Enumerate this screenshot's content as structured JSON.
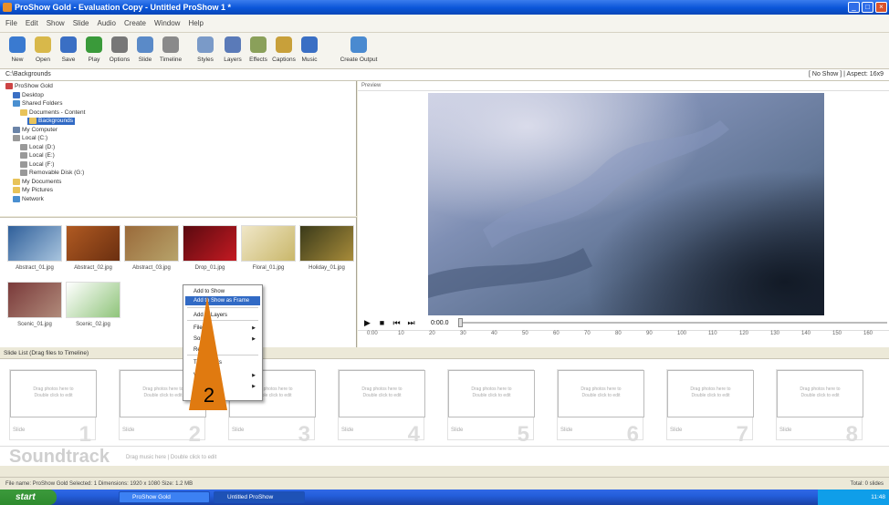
{
  "window": {
    "title": "ProShow Gold - Evaluation Copy - Untitled ProShow 1 *",
    "minimize": "_",
    "maximize": "□",
    "close": "×"
  },
  "menu": [
    "File",
    "Edit",
    "Show",
    "Slide",
    "Audio",
    "Create",
    "Window",
    "Help"
  ],
  "toolbar": [
    {
      "label": "New",
      "icon": "new-icon"
    },
    {
      "label": "Open",
      "icon": "open-icon"
    },
    {
      "label": "Save",
      "icon": "save-icon"
    },
    {
      "label": "Play",
      "icon": "play-icon"
    },
    {
      "label": "Options",
      "icon": "options-icon"
    },
    {
      "label": "Slide",
      "icon": "slide-icon"
    },
    {
      "label": "Timeline",
      "icon": "timeline-icon"
    },
    {
      "label": "Styles",
      "icon": "styles-icon"
    },
    {
      "label": "Layers",
      "icon": "layers-icon"
    },
    {
      "label": "Effects",
      "icon": "effects-icon"
    },
    {
      "label": "Captions",
      "icon": "captions-icon"
    },
    {
      "label": "Music",
      "icon": "music-icon"
    },
    {
      "label": "Create Output",
      "icon": "create-output-icon"
    }
  ],
  "pathbar": {
    "left": "C:\\Backgrounds",
    "right": "[ No Show ] | Aspect: 16x9"
  },
  "folder_tree": [
    {
      "label": "ProShow Gold",
      "indent": 0,
      "color": "#c44"
    },
    {
      "label": "Desktop",
      "indent": 1,
      "color": "#3a6fc4"
    },
    {
      "label": "Shared Folders",
      "indent": 1,
      "color": "#4a8fd0"
    },
    {
      "label": "Documents - Content",
      "indent": 2,
      "color": "#e8c35a"
    },
    {
      "label": "Backgrounds",
      "indent": 3,
      "color": "#e8c35a",
      "selected": true
    },
    {
      "label": "My Computer",
      "indent": 1,
      "color": "#6b84a8"
    },
    {
      "label": "Local (C:)",
      "indent": 1,
      "color": "#999"
    },
    {
      "label": "Local (D:)",
      "indent": 2,
      "color": "#999"
    },
    {
      "label": "Local (E:)",
      "indent": 2,
      "color": "#999"
    },
    {
      "label": "Local (F:)",
      "indent": 2,
      "color": "#999"
    },
    {
      "label": "Removable Disk (G:)",
      "indent": 2,
      "color": "#999"
    },
    {
      "label": "My Documents",
      "indent": 1,
      "color": "#e8c35a"
    },
    {
      "label": "My Pictures",
      "indent": 1,
      "color": "#e8c35a"
    },
    {
      "label": "Network",
      "indent": 1,
      "color": "#4a8fd0"
    }
  ],
  "files": [
    {
      "label": "Abstract_01.jpg",
      "colors": [
        "#2f5f9a",
        "#a8c4de"
      ]
    },
    {
      "label": "Abstract_02.jpg",
      "colors": [
        "#b05a22",
        "#6b2f10"
      ]
    },
    {
      "label": "Abstract_03.jpg",
      "colors": [
        "#9a6a3a",
        "#b7a36a"
      ]
    },
    {
      "label": "Drop_01.jpg",
      "colors": [
        "#5a0a10",
        "#c41a22"
      ]
    },
    {
      "label": "Floral_01.jpg",
      "colors": [
        "#f0e7c8",
        "#c9b76a"
      ]
    },
    {
      "label": "Holiday_01.jpg",
      "colors": [
        "#3a3a1a",
        "#a88c3a"
      ]
    },
    {
      "label": "Scenic_01.jpg",
      "colors": [
        "#7a3a3a",
        "#b08a7a"
      ]
    },
    {
      "label": "Scenic_02.jpg",
      "colors": [
        "#ffffff",
        "#8fc47a"
      ]
    }
  ],
  "preview": {
    "header": "Preview"
  },
  "playback": {
    "time": "0:00.0",
    "ruler": [
      "0:00",
      "10",
      "20",
      "30",
      "40",
      "50",
      "60",
      "70",
      "80",
      "90",
      "100",
      "110",
      "120",
      "130",
      "140",
      "150",
      "160"
    ]
  },
  "slidelist": {
    "header": "Slide List  (Drag files to Timeline)",
    "placeholder_a": "Drag photos here to",
    "placeholder_b": "Double click to edit",
    "slide_tag": "Slide",
    "numbers": [
      "1",
      "2",
      "3",
      "4",
      "5",
      "6",
      "7",
      "8"
    ]
  },
  "soundtrack": {
    "label": "Soundtrack",
    "hint": "Drag music here   |   Double click to edit"
  },
  "status": {
    "left": "File name:  ProShow Gold  Selected: 1   Dimensions: 1920 x 1080   Size: 1.2 MB",
    "right": "Total: 0 slides"
  },
  "context_menu": {
    "items": [
      {
        "label": "Add to Show",
        "highlight": false,
        "arrow": false
      },
      {
        "label": "Add to Show as Frame",
        "highlight": true,
        "arrow": false
      },
      {
        "label": "Add to Layers",
        "highlight": false,
        "arrow": false
      },
      {
        "label": "File",
        "highlight": false,
        "arrow": true
      },
      {
        "label": "Sort",
        "highlight": false,
        "arrow": true
      },
      {
        "label": "Refresh",
        "highlight": false,
        "arrow": false
      },
      {
        "label": "Thumbnails",
        "highlight": false,
        "arrow": false
      },
      {
        "label": "View",
        "highlight": false,
        "arrow": true
      },
      {
        "label": "Folder",
        "highlight": false,
        "arrow": true
      }
    ]
  },
  "callout": {
    "number": "2",
    "color": "#e07a10"
  },
  "taskbar": {
    "start": "start",
    "apps": [
      "ProShow Gold",
      "Untitled ProShow"
    ],
    "clock": "11:48"
  }
}
